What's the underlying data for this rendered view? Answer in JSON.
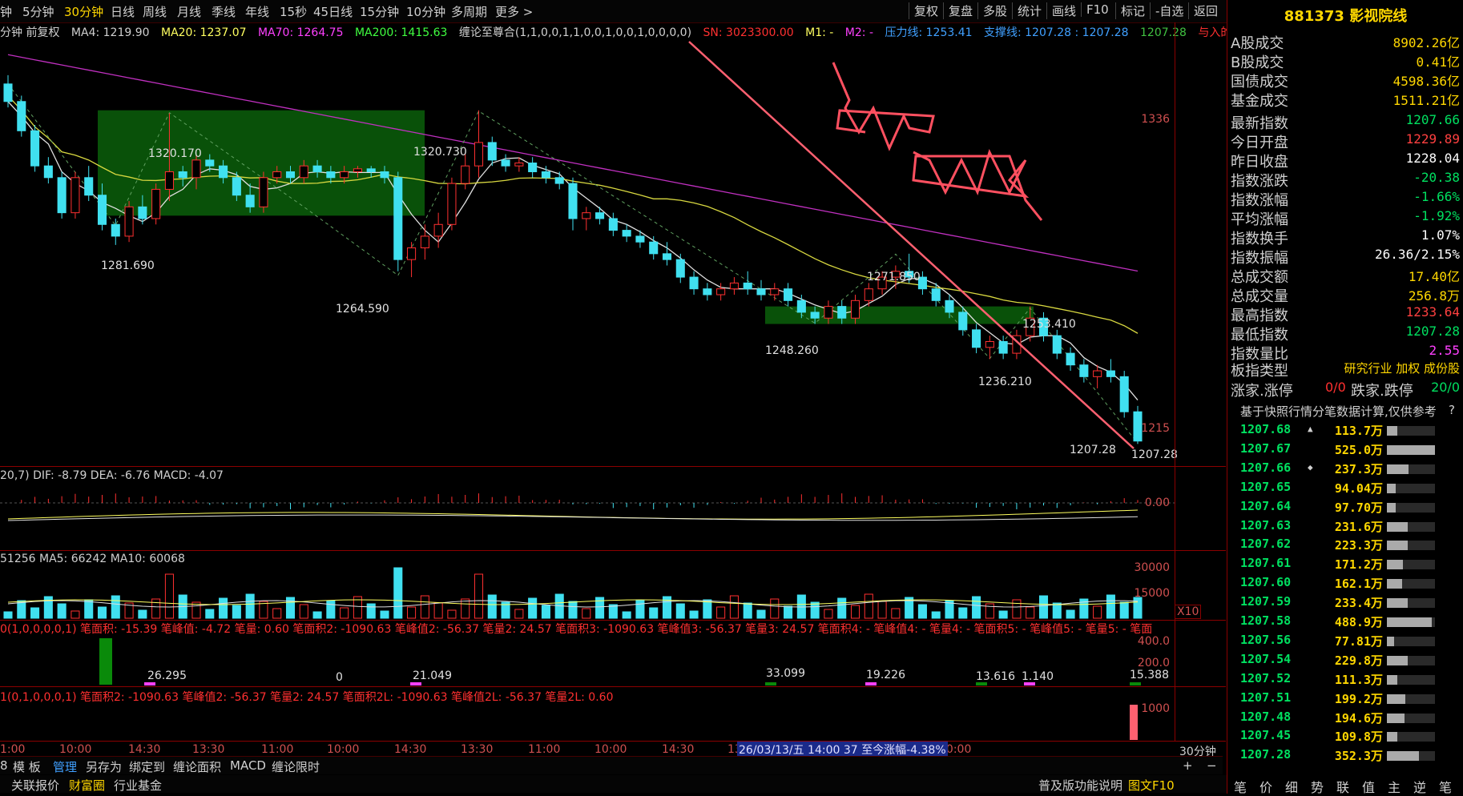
{
  "toolbar": {
    "periods": [
      "钟",
      "5分钟",
      "30分钟",
      "日线",
      "周线",
      "月线",
      "季线",
      "年线",
      "15秒",
      "45日线",
      "15分钟",
      "10分钟",
      "多周期",
      "更多 >"
    ],
    "right_buttons": [
      "复权",
      "复盘",
      "多股",
      "统计",
      "画线",
      "F10",
      "标记",
      "-自选",
      "返回"
    ]
  },
  "legend": {
    "prefix": "分钟 前复权",
    "ma4": "MA4: 1219.90",
    "ma20": "MA20: 1237.07",
    "ma70": "MA70: 1264.75",
    "ma200": "MA200: 1415.63",
    "chan": "缠论至尊合(1,1,0,0,1,1,0,0,1,0,0,1,0,0,0,0)",
    "sn": "SN: 3023300.00",
    "m1": "M1: -",
    "m2": "M2: -",
    "pressure": "压力线: 1253.41",
    "support": "支撑线: 1207.28 : 1207.28",
    "v1207": "1207.28",
    "yuru": "与入的◇"
  },
  "price_axis": [
    "1336",
    "1215"
  ],
  "price_labels": [
    {
      "text": "1320.170"
    },
    {
      "text": "1281.690"
    },
    {
      "text": "1320.730"
    },
    {
      "text": "1264.590"
    },
    {
      "text": "1271.850"
    },
    {
      "text": "1248.260"
    },
    {
      "text": "1253.410"
    },
    {
      "text": "1236.210"
    },
    {
      "text": "1207.28"
    },
    {
      "text": "1207.28"
    }
  ],
  "macd": {
    "legend": "20,7)  DIF: -8.79  DEA: -6.76  MACD: -4.07",
    "axis": "0.00"
  },
  "volume": {
    "legend": "51256  MA5: 66242  MA10: 60068",
    "axis": [
      "30000",
      "15000"
    ],
    "unit": "X10"
  },
  "ind3": {
    "legend": "0(1,0,0,0,0,1)  笔面积: -15.39  笔峰值: -4.72  笔量: 0.60  笔面积2: -1090.63  笔峰值2: -56.37  笔量2: 24.57  笔面积3: -1090.63  笔峰值3: -56.37  笔量3: 24.57  笔面积4: -  笔峰值4: -  笔量4: -  笔面积5: -  笔峰值5: -  笔量5: -  笔面",
    "axis": [
      "400.0",
      "200.0"
    ],
    "values": [
      "26.295",
      "0",
      "21.049",
      "33.099",
      "19.226",
      "13.616",
      "1.140",
      "15.388"
    ]
  },
  "ind4": {
    "legend": "1(0,1,0,0,0,1)  笔面积2: -1090.63  笔峰值2: -56.37  笔量2: 24.57  笔面积2L: -1090.63  笔峰值2L: -56.37  笔量2L: 0.60",
    "axis": "1000"
  },
  "time_axis": [
    "1:00",
    "10:00",
    "14:30",
    "13:30",
    "11:00",
    "10:00",
    "14:30",
    "13:30",
    "11:00",
    "10:00",
    "14:30",
    "13:30",
    "11:00",
    "10:00"
  ],
  "time_tooltip": "26/03/13/五 14:00 37 至今涨幅-4.38%",
  "period_label": "30分钟",
  "bottom_tabs1": [
    "8",
    "模 板",
    "管理",
    "另存为",
    "绑定到",
    "缠论面积",
    "MACD",
    "缠论限时"
  ],
  "bottom_tabs2": [
    "关联报价",
    "财富圈",
    "行业基金",
    "普及版功能说明",
    "图文F10"
  ],
  "right_panel": {
    "title": "881373 影视院线",
    "rows": [
      {
        "k": "A股成交",
        "v": "8902.26亿",
        "c": "#ffd700"
      },
      {
        "k": "B股成交",
        "v": "0.41亿",
        "c": "#ffd700"
      },
      {
        "k": "国债成交",
        "v": "4598.36亿",
        "c": "#ffd700"
      },
      {
        "k": "基金成交",
        "v": "1511.21亿",
        "c": "#ffd700"
      },
      {
        "k": "最新指数",
        "v": "1207.66",
        "c": "#00e060"
      },
      {
        "k": "今日开盘",
        "v": "1229.89",
        "c": "#ff4040"
      },
      {
        "k": "昨日收盘",
        "v": "1228.04",
        "c": "#ffffff"
      },
      {
        "k": "指数涨跌",
        "v": "-20.38",
        "c": "#00e060"
      },
      {
        "k": "指数涨幅",
        "v": "-1.66%",
        "c": "#00e060"
      },
      {
        "k": "平均涨幅",
        "v": "-1.92%",
        "c": "#00e060"
      },
      {
        "k": "指数换手",
        "v": "1.07%",
        "c": "#ffffff"
      },
      {
        "k": "指数振幅",
        "v": "26.36/2.15%",
        "c": "#ffffff"
      },
      {
        "k": "总成交额",
        "v": "17.40亿",
        "c": "#ffd700"
      },
      {
        "k": "总成交量",
        "v": "256.8万",
        "c": "#ffd700"
      },
      {
        "k": "最高指数",
        "v": "1233.64",
        "c": "#ff4040"
      },
      {
        "k": "最低指数",
        "v": "1207.28",
        "c": "#00e060"
      },
      {
        "k": "指数量比",
        "v": "2.55",
        "c": "#ff40ff"
      }
    ],
    "type_label": "板指类型",
    "type_value": "研究行业 加权 成份股",
    "zhangting_label": "涨家.涨停",
    "zhangting_value": "0/0",
    "dieting_label": "跌家.跌停",
    "dieting_value": "20/0",
    "note": "基于快照行情分笔数据计算,仅供参考",
    "note_q": "?",
    "ticks": [
      {
        "p": "1207.68",
        "q": "113.7万",
        "r": 0.22,
        "mark": "▲"
      },
      {
        "p": "1207.67",
        "q": "525.0万",
        "r": 1.0,
        "mark": ""
      },
      {
        "p": "1207.66",
        "q": "237.3万",
        "r": 0.45,
        "mark": "◆"
      },
      {
        "p": "1207.65",
        "q": "94.04万",
        "r": 0.18,
        "mark": ""
      },
      {
        "p": "1207.64",
        "q": "97.70万",
        "r": 0.19,
        "mark": ""
      },
      {
        "p": "1207.63",
        "q": "231.6万",
        "r": 0.44,
        "mark": ""
      },
      {
        "p": "1207.62",
        "q": "223.3万",
        "r": 0.43,
        "mark": ""
      },
      {
        "p": "1207.61",
        "q": "171.2万",
        "r": 0.33,
        "mark": ""
      },
      {
        "p": "1207.60",
        "q": "162.1万",
        "r": 0.31,
        "mark": ""
      },
      {
        "p": "1207.59",
        "q": "233.4万",
        "r": 0.44,
        "mark": ""
      },
      {
        "p": "1207.58",
        "q": "488.9万",
        "r": 0.93,
        "mark": ""
      },
      {
        "p": "1207.56",
        "q": "77.81万",
        "r": 0.15,
        "mark": ""
      },
      {
        "p": "1207.54",
        "q": "229.8万",
        "r": 0.44,
        "mark": ""
      },
      {
        "p": "1207.52",
        "q": "111.3万",
        "r": 0.21,
        "mark": ""
      },
      {
        "p": "1207.51",
        "q": "199.2万",
        "r": 0.38,
        "mark": ""
      },
      {
        "p": "1207.48",
        "q": "194.6万",
        "r": 0.37,
        "mark": ""
      },
      {
        "p": "1207.45",
        "q": "109.8万",
        "r": 0.21,
        "mark": ""
      },
      {
        "p": "1207.28",
        "q": "352.3万",
        "r": 0.67,
        "mark": ""
      }
    ],
    "bottom": [
      "笔",
      "价",
      "细",
      "势",
      "联",
      "值",
      "主",
      "逆",
      "笔"
    ]
  },
  "chart_data": {
    "type": "candlestick",
    "candles": [
      [
        1330,
        1333,
        1322,
        1324
      ],
      [
        1324,
        1326,
        1312,
        1314
      ],
      [
        1314,
        1316,
        1300,
        1302
      ],
      [
        1302,
        1305,
        1296,
        1298
      ],
      [
        1298,
        1300,
        1284,
        1286
      ],
      [
        1286,
        1300,
        1284,
        1298
      ],
      [
        1298,
        1302,
        1290,
        1292
      ],
      [
        1292,
        1296,
        1280,
        1282
      ],
      [
        1282,
        1284,
        1275,
        1278
      ],
      [
        1278,
        1290,
        1276,
        1288
      ],
      [
        1288,
        1292,
        1282,
        1284
      ],
      [
        1284,
        1296,
        1282,
        1294
      ],
      [
        1294,
        1320,
        1290,
        1300
      ],
      [
        1300,
        1302,
        1295,
        1298
      ],
      [
        1298,
        1306,
        1294,
        1304
      ],
      [
        1304,
        1306,
        1300,
        1302
      ],
      [
        1302,
        1304,
        1296,
        1298
      ],
      [
        1298,
        1300,
        1290,
        1292
      ],
      [
        1292,
        1296,
        1286,
        1288
      ],
      [
        1288,
        1300,
        1286,
        1298
      ],
      [
        1298,
        1302,
        1296,
        1300
      ],
      [
        1300,
        1302,
        1296,
        1298
      ],
      [
        1298,
        1304,
        1296,
        1302
      ],
      [
        1302,
        1304,
        1298,
        1300
      ],
      [
        1300,
        1302,
        1296,
        1298
      ],
      [
        1298,
        1302,
        1296,
        1300
      ],
      [
        1300,
        1302,
        1298,
        1301
      ],
      [
        1301,
        1302,
        1298,
        1300
      ],
      [
        1300,
        1302,
        1296,
        1298
      ],
      [
        1298,
        1300,
        1266,
        1270
      ],
      [
        1270,
        1276,
        1264,
        1274
      ],
      [
        1274,
        1282,
        1270,
        1278
      ],
      [
        1278,
        1286,
        1274,
        1282
      ],
      [
        1282,
        1298,
        1280,
        1296
      ],
      [
        1296,
        1306,
        1294,
        1302
      ],
      [
        1302,
        1321,
        1298,
        1310
      ],
      [
        1310,
        1312,
        1302,
        1304
      ],
      [
        1304,
        1306,
        1300,
        1302
      ],
      [
        1302,
        1305,
        1300,
        1303
      ],
      [
        1303,
        1305,
        1298,
        1300
      ],
      [
        1300,
        1302,
        1296,
        1298
      ],
      [
        1298,
        1300,
        1294,
        1296
      ],
      [
        1296,
        1298,
        1280,
        1284
      ],
      [
        1284,
        1288,
        1280,
        1286
      ],
      [
        1286,
        1288,
        1282,
        1284
      ],
      [
        1284,
        1286,
        1278,
        1280
      ],
      [
        1280,
        1282,
        1276,
        1278
      ],
      [
        1278,
        1280,
        1274,
        1276
      ],
      [
        1276,
        1278,
        1270,
        1272
      ],
      [
        1272,
        1276,
        1268,
        1270
      ],
      [
        1270,
        1272,
        1262,
        1264
      ],
      [
        1264,
        1266,
        1258,
        1260
      ],
      [
        1260,
        1262,
        1256,
        1258
      ],
      [
        1258,
        1262,
        1256,
        1260
      ],
      [
        1260,
        1264,
        1258,
        1262
      ],
      [
        1262,
        1266,
        1258,
        1260
      ],
      [
        1260,
        1263,
        1256,
        1258
      ],
      [
        1258,
        1262,
        1256,
        1260
      ],
      [
        1260,
        1262,
        1254,
        1256
      ],
      [
        1256,
        1258,
        1250,
        1252
      ],
      [
        1252,
        1254,
        1248,
        1250
      ],
      [
        1250,
        1256,
        1248,
        1254
      ],
      [
        1254,
        1256,
        1248,
        1250
      ],
      [
        1250,
        1258,
        1248,
        1256
      ],
      [
        1256,
        1262,
        1254,
        1260
      ],
      [
        1260,
        1266,
        1258,
        1264
      ],
      [
        1264,
        1268,
        1260,
        1266
      ],
      [
        1266,
        1272,
        1262,
        1264
      ],
      [
        1264,
        1266,
        1258,
        1260
      ],
      [
        1260,
        1262,
        1254,
        1256
      ],
      [
        1256,
        1258,
        1250,
        1252
      ],
      [
        1252,
        1254,
        1244,
        1246
      ],
      [
        1246,
        1248,
        1238,
        1240
      ],
      [
        1240,
        1244,
        1236,
        1242
      ],
      [
        1242,
        1244,
        1236,
        1238
      ],
      [
        1238,
        1246,
        1236,
        1244
      ],
      [
        1244,
        1254,
        1242,
        1250
      ],
      [
        1250,
        1252,
        1242,
        1244
      ],
      [
        1244,
        1246,
        1236,
        1238
      ],
      [
        1238,
        1240,
        1232,
        1234
      ],
      [
        1234,
        1236,
        1228,
        1230
      ],
      [
        1230,
        1234,
        1226,
        1232
      ],
      [
        1232,
        1236,
        1228,
        1230
      ],
      [
        1230,
        1232,
        1216,
        1218
      ],
      [
        1218,
        1220,
        1207,
        1208
      ]
    ],
    "macd": {
      "dif": -8.79,
      "dea": -6.76,
      "macd": -4.07
    },
    "volume": {
      "ma5": 66242,
      "ma10": 60068
    },
    "ylim": [
      1200,
      1345
    ]
  }
}
